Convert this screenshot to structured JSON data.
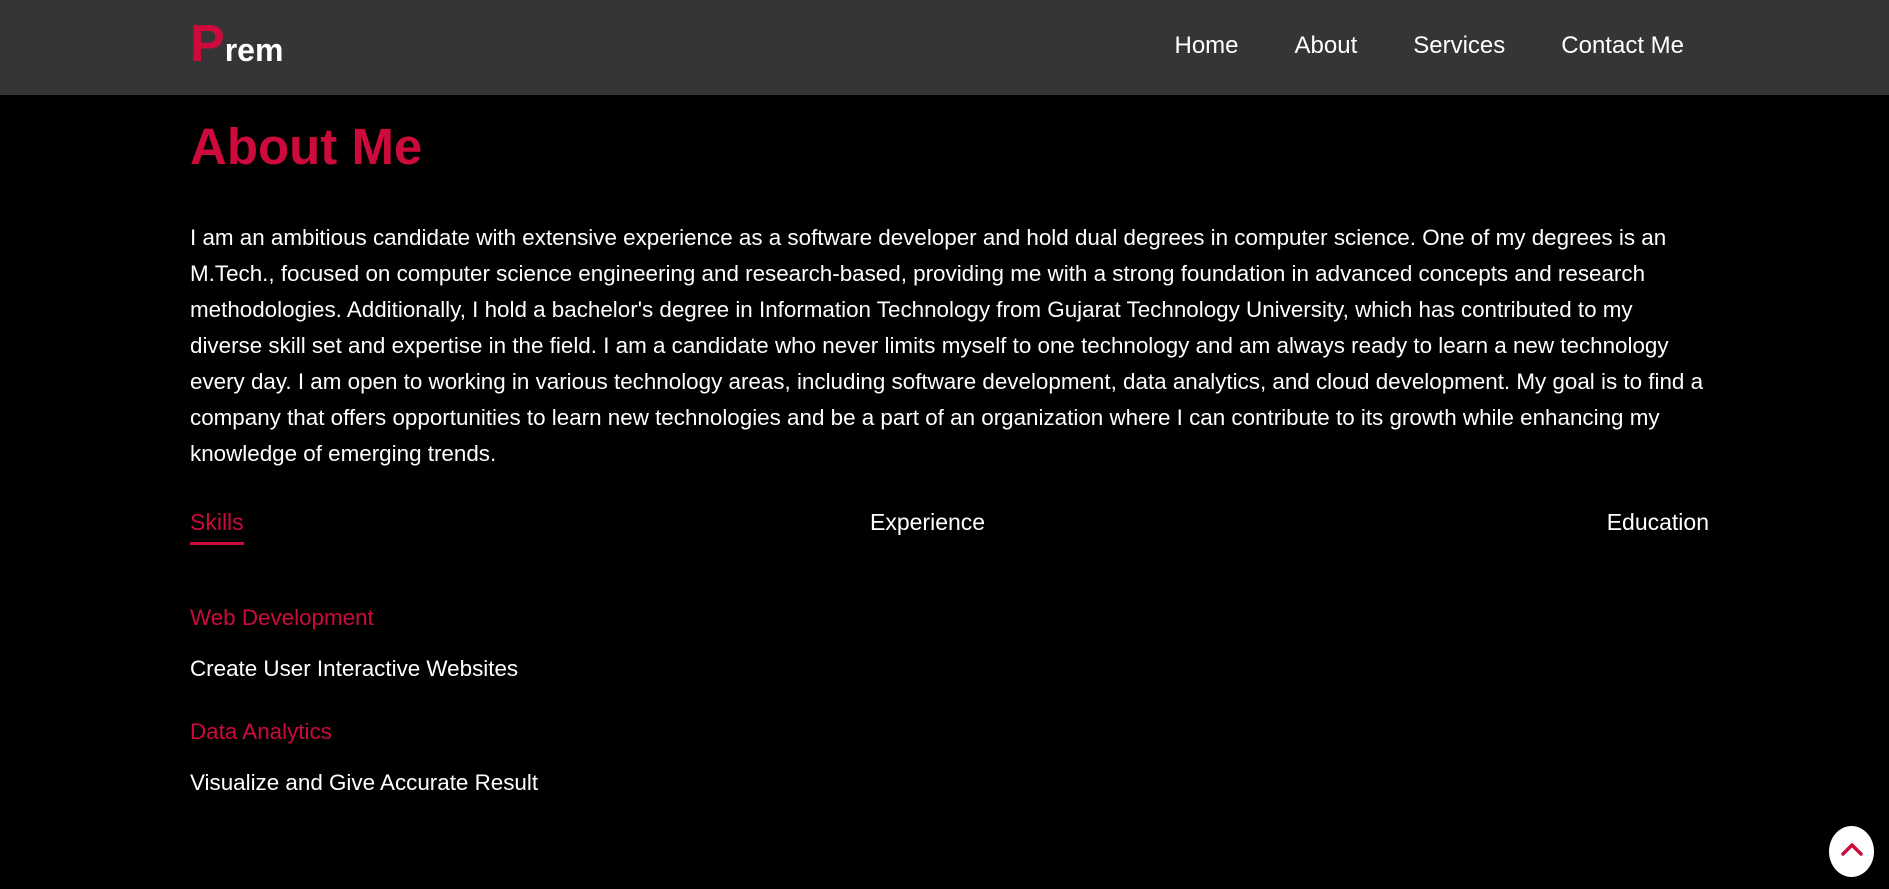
{
  "logo": {
    "first_letter": "P",
    "rest": "rem"
  },
  "nav": {
    "items": [
      {
        "label": "Home"
      },
      {
        "label": "About"
      },
      {
        "label": "Services"
      },
      {
        "label": "Contact Me"
      }
    ]
  },
  "about": {
    "title": "About Me",
    "paragraph": "I am an ambitious candidate with extensive experience as a software developer and hold dual degrees in computer science. One of my degrees is an M.Tech., focused on computer science engineering and research-based, providing me with a strong foundation in advanced concepts and research methodologies. Additionally, I hold a bachelor's degree in Information Technology from Gujarat Technology University, which has contributed to my diverse skill set and expertise in the field. I am a candidate who never limits myself to one technology and am always ready to learn a new technology every day. I am open to working in various technology areas, including software development, data analytics, and cloud development. My goal is to find a company that offers opportunities to learn new technologies and be a part of an organization where I can contribute to its growth while enhancing my knowledge of emerging trends."
  },
  "tabs": [
    {
      "label": "Skills",
      "active": true
    },
    {
      "label": "Experience",
      "active": false
    },
    {
      "label": "Education",
      "active": false
    }
  ],
  "skills": [
    {
      "name": "Web Development",
      "description": "Create User Interactive Websites"
    },
    {
      "name": "Data Analytics",
      "description": "Visualize and Give Accurate Result"
    }
  ],
  "colors": {
    "accent": "#cd0a3c",
    "navbar_bg": "#353535",
    "page_bg": "#000000",
    "text": "#ffffff"
  },
  "icons": {
    "scroll_top": "chevron-up-icon"
  }
}
